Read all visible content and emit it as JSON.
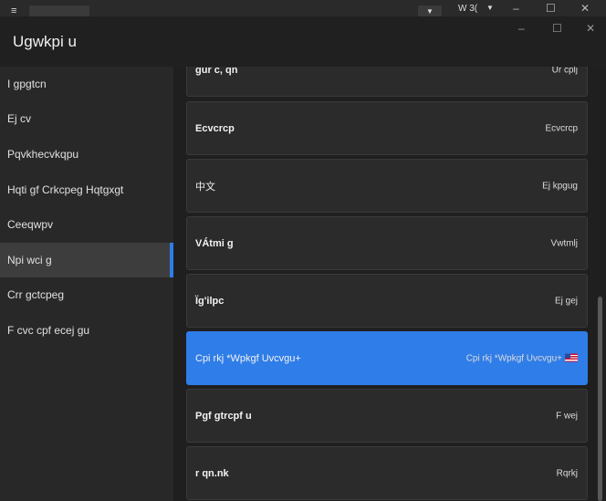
{
  "background_window": {
    "label": "W 3(",
    "minimize": "–",
    "maximize": "☐",
    "close": "✕"
  },
  "window": {
    "title": "Ugwkpi u",
    "minimize": "–",
    "maximize": "☐",
    "close": "✕"
  },
  "sidebar": {
    "items": [
      {
        "label": "I gpgtcn"
      },
      {
        "label": "Ej cv"
      },
      {
        "label": "Pqvkhecvkqpu"
      },
      {
        "label": "Hqti gf Crkcpeg Hqtgxgt"
      },
      {
        "label": "Ceeqwpv"
      },
      {
        "label": "Npi wci g"
      },
      {
        "label": "Crr gctcpeg"
      },
      {
        "label": "F cvc cpf ecej gu"
      }
    ],
    "selected_index": 5
  },
  "languages": [
    {
      "name": "gur c, qn",
      "native": "Ur cplj"
    },
    {
      "name": "Ecvcrcp",
      "native": "Ecvcrcp"
    },
    {
      "name": "中文",
      "native": "Ej kpgug"
    },
    {
      "name": "VÁtmi g",
      "native": "Vwtmlj"
    },
    {
      "name": "Ïg'ilpc",
      "native": "Ej gej"
    },
    {
      "name": "Cpi rkj *Wpkgf Uvcvgu+",
      "native": "Cpi rkj *Wpkgf Uvcvgu+",
      "selected": true,
      "flag": "us-flag-icon"
    },
    {
      "name": "Pgf gtrcpf u",
      "native": "F wej"
    },
    {
      "name": "r qn.nk",
      "native": "Rqrkj"
    }
  ],
  "colors": {
    "accent": "#2f7de8",
    "background": "#1f1f1f",
    "sidebar": "#282828",
    "card": "#2b2b2b"
  }
}
